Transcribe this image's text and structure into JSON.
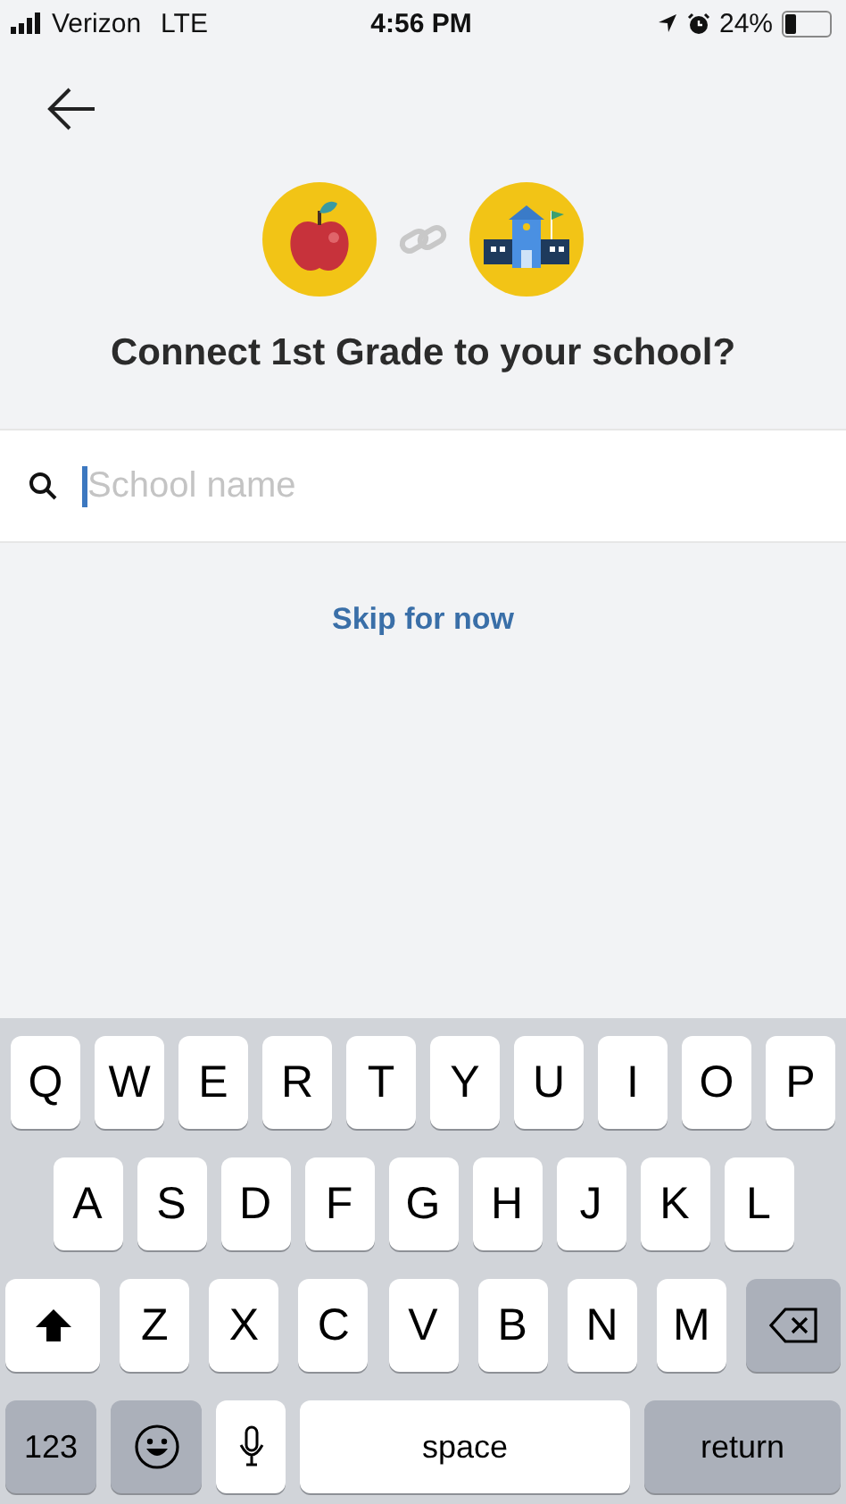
{
  "status_bar": {
    "carrier": "Verizon",
    "network": "LTE",
    "time": "4:56 PM",
    "battery_text": "24%"
  },
  "header": {
    "title": "Connect 1st Grade to your school?"
  },
  "search": {
    "placeholder": "School name"
  },
  "skip_link": "Skip for now",
  "keyboard": {
    "top_row": [
      {
        "kind": "letter",
        "label": "Q"
      },
      {
        "kind": "letter",
        "label": "W"
      },
      {
        "kind": "letter",
        "label": "E"
      },
      {
        "kind": "letter",
        "label": "R"
      },
      {
        "kind": "letter",
        "label": "T"
      },
      {
        "kind": "letter",
        "label": "Y"
      },
      {
        "kind": "letter",
        "label": "U"
      },
      {
        "kind": "letter",
        "label": "I"
      },
      {
        "kind": "letter",
        "label": "O"
      },
      {
        "kind": "letter",
        "label": "P"
      }
    ],
    "middle_row": [
      {
        "kind": "letter",
        "label": "A"
      },
      {
        "kind": "letter",
        "label": "S"
      },
      {
        "kind": "letter",
        "label": "D"
      },
      {
        "kind": "letter",
        "label": "F"
      },
      {
        "kind": "letter",
        "label": "G"
      },
      {
        "kind": "letter",
        "label": "H"
      },
      {
        "kind": "letter",
        "label": "J"
      },
      {
        "kind": "letter",
        "label": "K"
      },
      {
        "kind": "letter",
        "label": "L"
      }
    ],
    "bottom_row": [
      {
        "kind": "shift"
      },
      {
        "kind": "letter",
        "label": "Z"
      },
      {
        "kind": "letter",
        "label": "X"
      },
      {
        "kind": "letter",
        "label": "C"
      },
      {
        "kind": "letter",
        "label": "V"
      },
      {
        "kind": "letter",
        "label": "B"
      },
      {
        "kind": "letter",
        "label": "N"
      },
      {
        "kind": "letter",
        "label": "M"
      },
      {
        "kind": "delete"
      }
    ],
    "function_row": [
      {
        "kind": "numbers",
        "label": "123"
      },
      {
        "kind": "emoji"
      },
      {
        "kind": "mic"
      },
      {
        "kind": "space",
        "label": "space"
      },
      {
        "kind": "return",
        "label": "return"
      }
    ]
  }
}
